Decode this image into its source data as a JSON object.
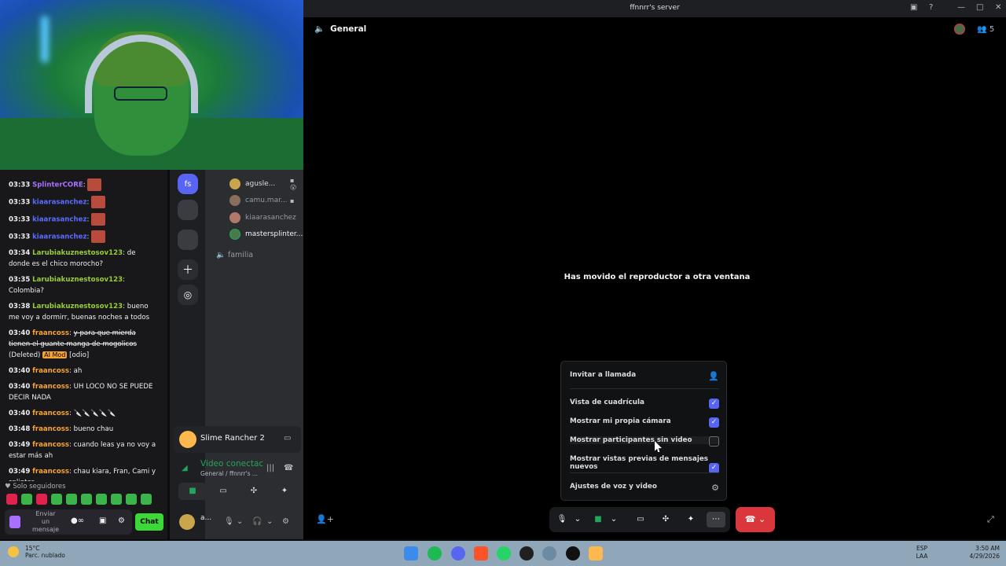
{
  "window": {
    "title": "ffnnrr's server"
  },
  "chat": {
    "messages": [
      {
        "time": "03:33",
        "user": "SplinterCORE",
        "color": "#a970ff",
        "text": ""
      },
      {
        "time": "03:33",
        "user": "kiaarasanchez",
        "color": "#5c6bff",
        "text": ""
      },
      {
        "time": "03:33",
        "user": "kiaarasanchez",
        "color": "#5c6bff",
        "text": ""
      },
      {
        "time": "03:33",
        "user": "kiaarasanchez",
        "color": "#5c6bff",
        "text": ""
      },
      {
        "time": "03:34",
        "user": "Larubiakuznestosov123",
        "color": "#9acd32",
        "text": "de donde es el chico morocho?"
      },
      {
        "time": "03:35",
        "user": "Larubiakuznestosov123",
        "color": "#9acd32",
        "text": "Colombia?"
      },
      {
        "time": "03:38",
        "user": "Larubiakuznestosov123",
        "color": "#9acd32",
        "text": "bueno me voy a dormirr, buenas noches a todos"
      },
      {
        "time": "03:40",
        "user": "fraancoss",
        "color": "#f6a434",
        "text": "y para que mierda tienen el guante manga de mogolicos",
        "deleted": "(Deleted)",
        "badge": "AI Mod",
        "tag": "[odio]"
      },
      {
        "time": "03:40",
        "user": "fraancoss",
        "color": "#f6a434",
        "text": "ah"
      },
      {
        "time": "03:40",
        "user": "fraancoss",
        "color": "#f6a434",
        "text": "UH LOCO NO SE PUEDE DECIR NADA"
      },
      {
        "time": "03:40",
        "user": "fraancoss",
        "color": "#f6a434",
        "text": "🔪🔪🔪🔪🔪"
      },
      {
        "time": "03:48",
        "user": "fraancoss",
        "color": "#f6a434",
        "text": "bueno chau"
      },
      {
        "time": "03:49",
        "user": "fraancoss",
        "color": "#f6a434",
        "text": "cuando leas ya no voy a estar más ah"
      },
      {
        "time": "03:49",
        "user": "fraancoss",
        "color": "#f6a434",
        "text": "chau kiara, Fran, Cami y splinter"
      }
    ],
    "followers_only": "Solo seguidores",
    "send_placeholder": "Enviar un mensaje",
    "chat_button": "Chat"
  },
  "rail": {
    "server_abbrev": "fs"
  },
  "voice_users": [
    {
      "name": "agusle..."
    },
    {
      "name": "camu.mar..."
    },
    {
      "name": "kiaarasanchez"
    },
    {
      "name": "mastersplinter..."
    }
  ],
  "channel_familia": "familia",
  "activity": {
    "game": "Slime Rancher 2"
  },
  "voice_panel": {
    "status": "Video conectac",
    "sub": "General / ffnnrr's ..."
  },
  "userbar": {
    "name": "a..."
  },
  "main": {
    "channel": "General",
    "member_count": "5",
    "moved_message": "Has movido el reproductor a otra ventana"
  },
  "menu": {
    "invite": "Invitar a llamada",
    "items": [
      {
        "label": "Vista de cuadrícula",
        "checked": true
      },
      {
        "label": "Mostrar mi propia cámara",
        "checked": true
      },
      {
        "label": "Mostrar participantes sin video",
        "checked": false
      },
      {
        "label": "Mostrar vistas previas de mensajes nuevos",
        "checked": true
      }
    ],
    "settings": "Ajustes de voz y video"
  },
  "taskbar": {
    "temp": "15°C",
    "weather": "Parc. nublado",
    "lang1": "ESP",
    "lang2": "LAA",
    "time": "3:50 AM",
    "date": "4/29/2026"
  },
  "colors": {
    "accent": "#5865f2",
    "hangup": "#da373c",
    "connected": "#23a55a",
    "twitch_purple": "#a970ff",
    "chat_button": "#3bd838"
  }
}
